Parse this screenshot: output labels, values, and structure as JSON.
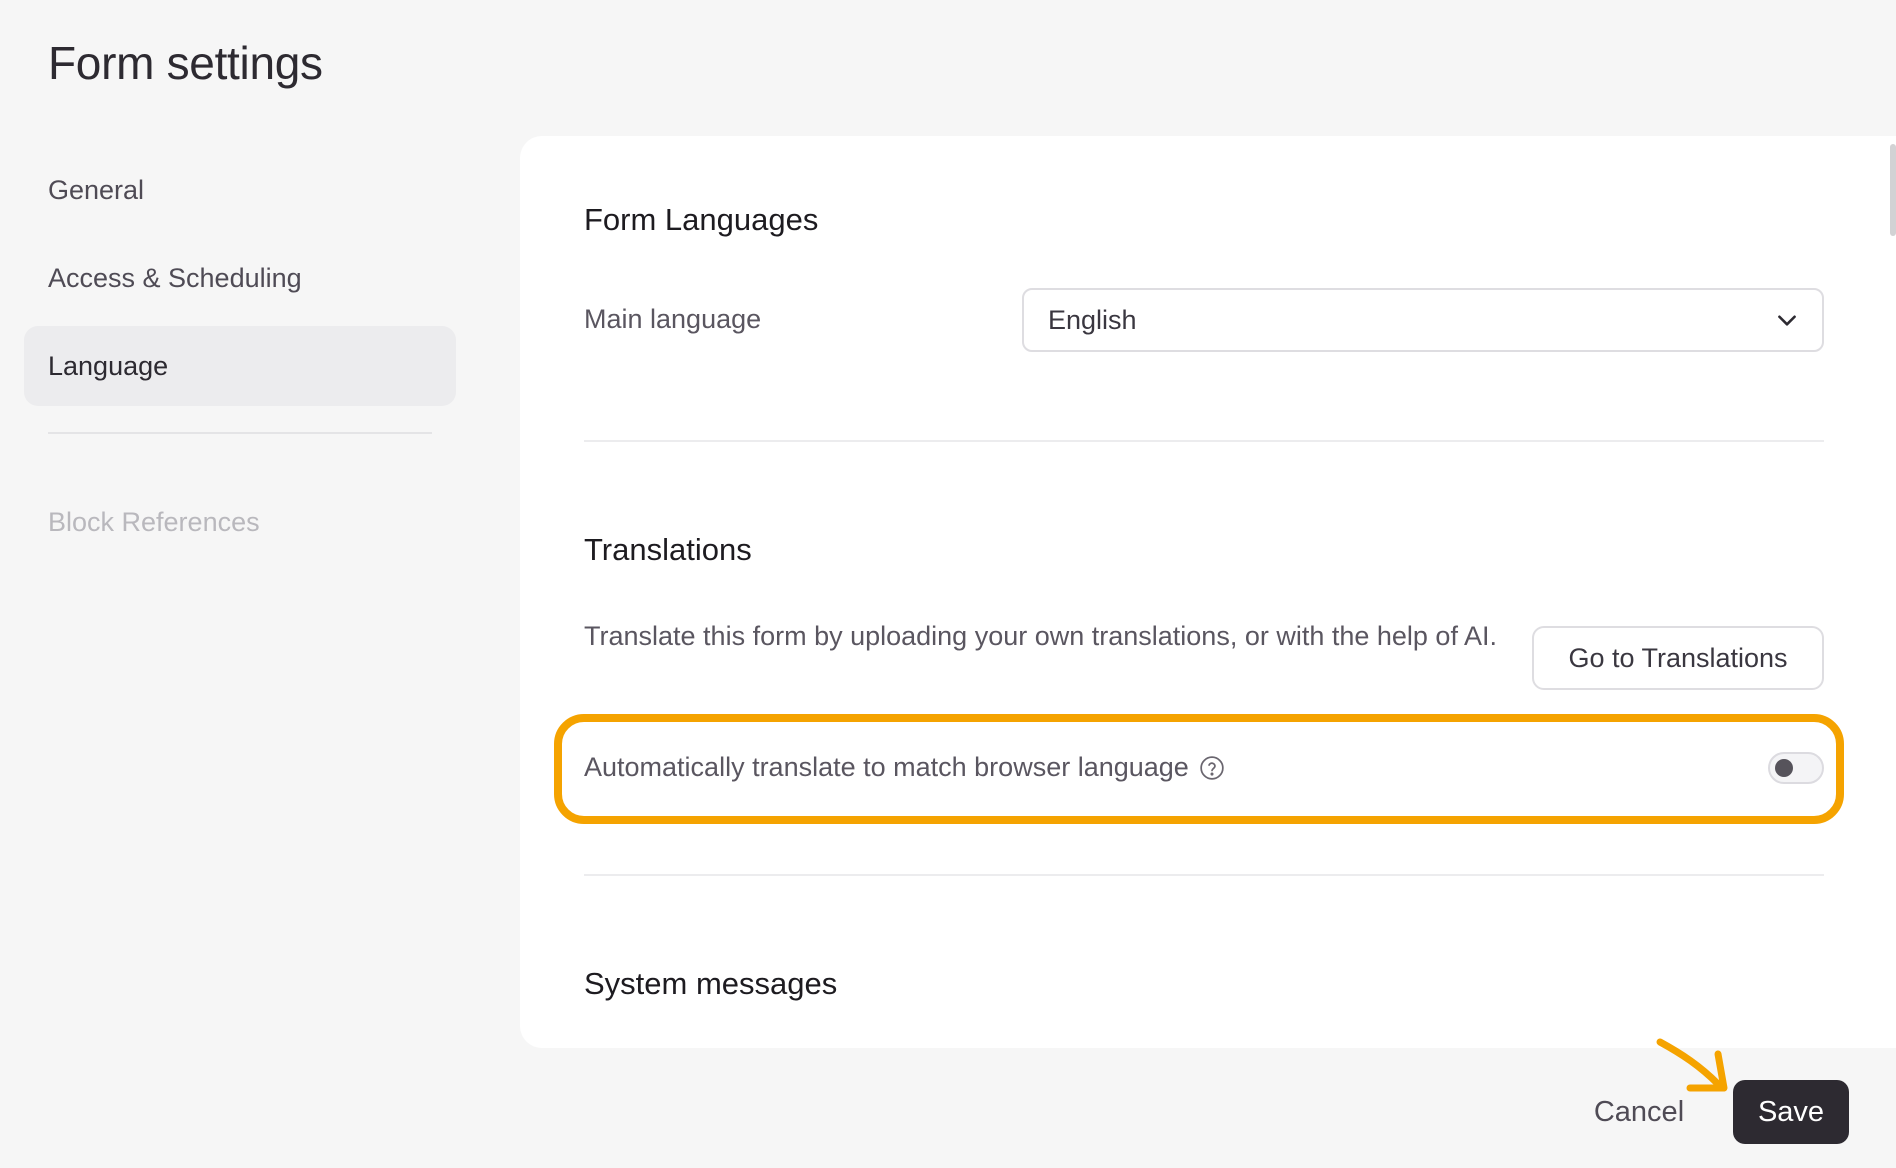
{
  "header": {
    "title": "Form settings"
  },
  "sidebar": {
    "items": [
      {
        "label": "General"
      },
      {
        "label": "Access & Scheduling"
      },
      {
        "label": "Language",
        "active": true
      }
    ],
    "disabled_items": [
      {
        "label": "Block References"
      }
    ]
  },
  "main": {
    "form_languages": {
      "heading": "Form Languages",
      "main_language_label": "Main language",
      "main_language_value": "English"
    },
    "translations": {
      "heading": "Translations",
      "description": "Translate this form by uploading your own translations, or with the help of AI.",
      "go_button_label": "Go to Translations",
      "auto_translate_label": "Automatically translate to match browser language",
      "auto_translate_enabled": false
    },
    "system_messages": {
      "heading": "System messages"
    }
  },
  "footer": {
    "cancel_label": "Cancel",
    "save_label": "Save"
  },
  "colors": {
    "highlight": "#f5a300",
    "primary_button": "#2d2a31",
    "background": "#f6f6f6",
    "panel": "#ffffff"
  },
  "icons": [
    "chevron-down-icon",
    "help-circle-icon",
    "annotation-arrow-icon"
  ]
}
